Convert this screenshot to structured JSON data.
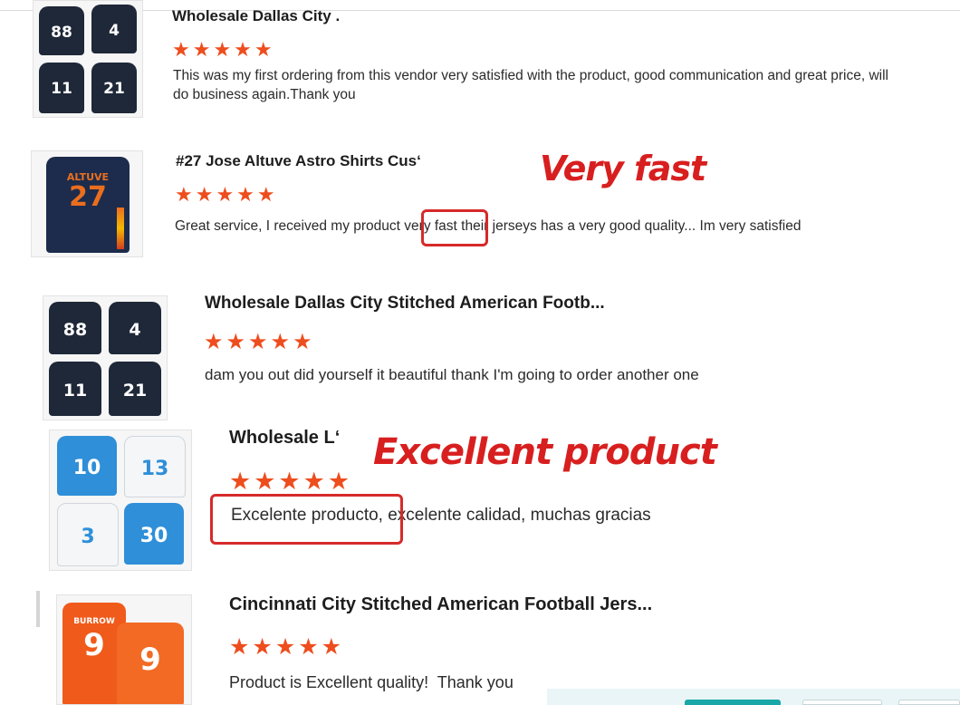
{
  "reviews": [
    {
      "title": "Wholesale Dallas City .",
      "stars": "★★★★★",
      "text": "This was my first ordering from this vendor very satisfied with the product, good communication and great price, will do business again.Thank you",
      "numbers": [
        "88",
        "4",
        "11",
        "21"
      ]
    },
    {
      "title": "#27 Jose Altuve Astro Shirts Cus‘",
      "stars": "★★★★★",
      "text_before": "Great service, I received my product",
      "highlight": "very fast",
      "text_after": " their jerseys has a very good quality... Im very satisfied",
      "jersey_name": "ALTUVE",
      "jersey_number": "27"
    },
    {
      "title": "Wholesale Dallas City Stitched American Footb...",
      "stars": "★★★★★",
      "text": "dam you out did yourself it beautiful thank I'm going to order another one",
      "numbers": [
        "88",
        "4",
        "11",
        "21"
      ]
    },
    {
      "title": "Wholesale L‘",
      "stars": "★★★★★",
      "highlight": "Excelente producto,",
      "text_after": " excelente calidad, muchas gracias",
      "numbers": [
        "10",
        "13",
        "3",
        "30"
      ]
    },
    {
      "title": "Cincinnati City Stitched American Football Jers...",
      "stars": "★★★★★",
      "text": "Product is Excellent quality!  Thank you",
      "jersey_name": "BURROW",
      "jersey_number": "9"
    }
  ],
  "callouts": {
    "very_fast": "Very fast",
    "excellent_product": "Excellent product"
  },
  "colors": {
    "star": "#ee4d1e",
    "callout": "#d81f1f",
    "cowboys_navy": "#1e2838",
    "chargers_blue": "#2f8fd8",
    "bengals_orange": "#f05a1a",
    "astros_navy": "#1d2c4c"
  }
}
